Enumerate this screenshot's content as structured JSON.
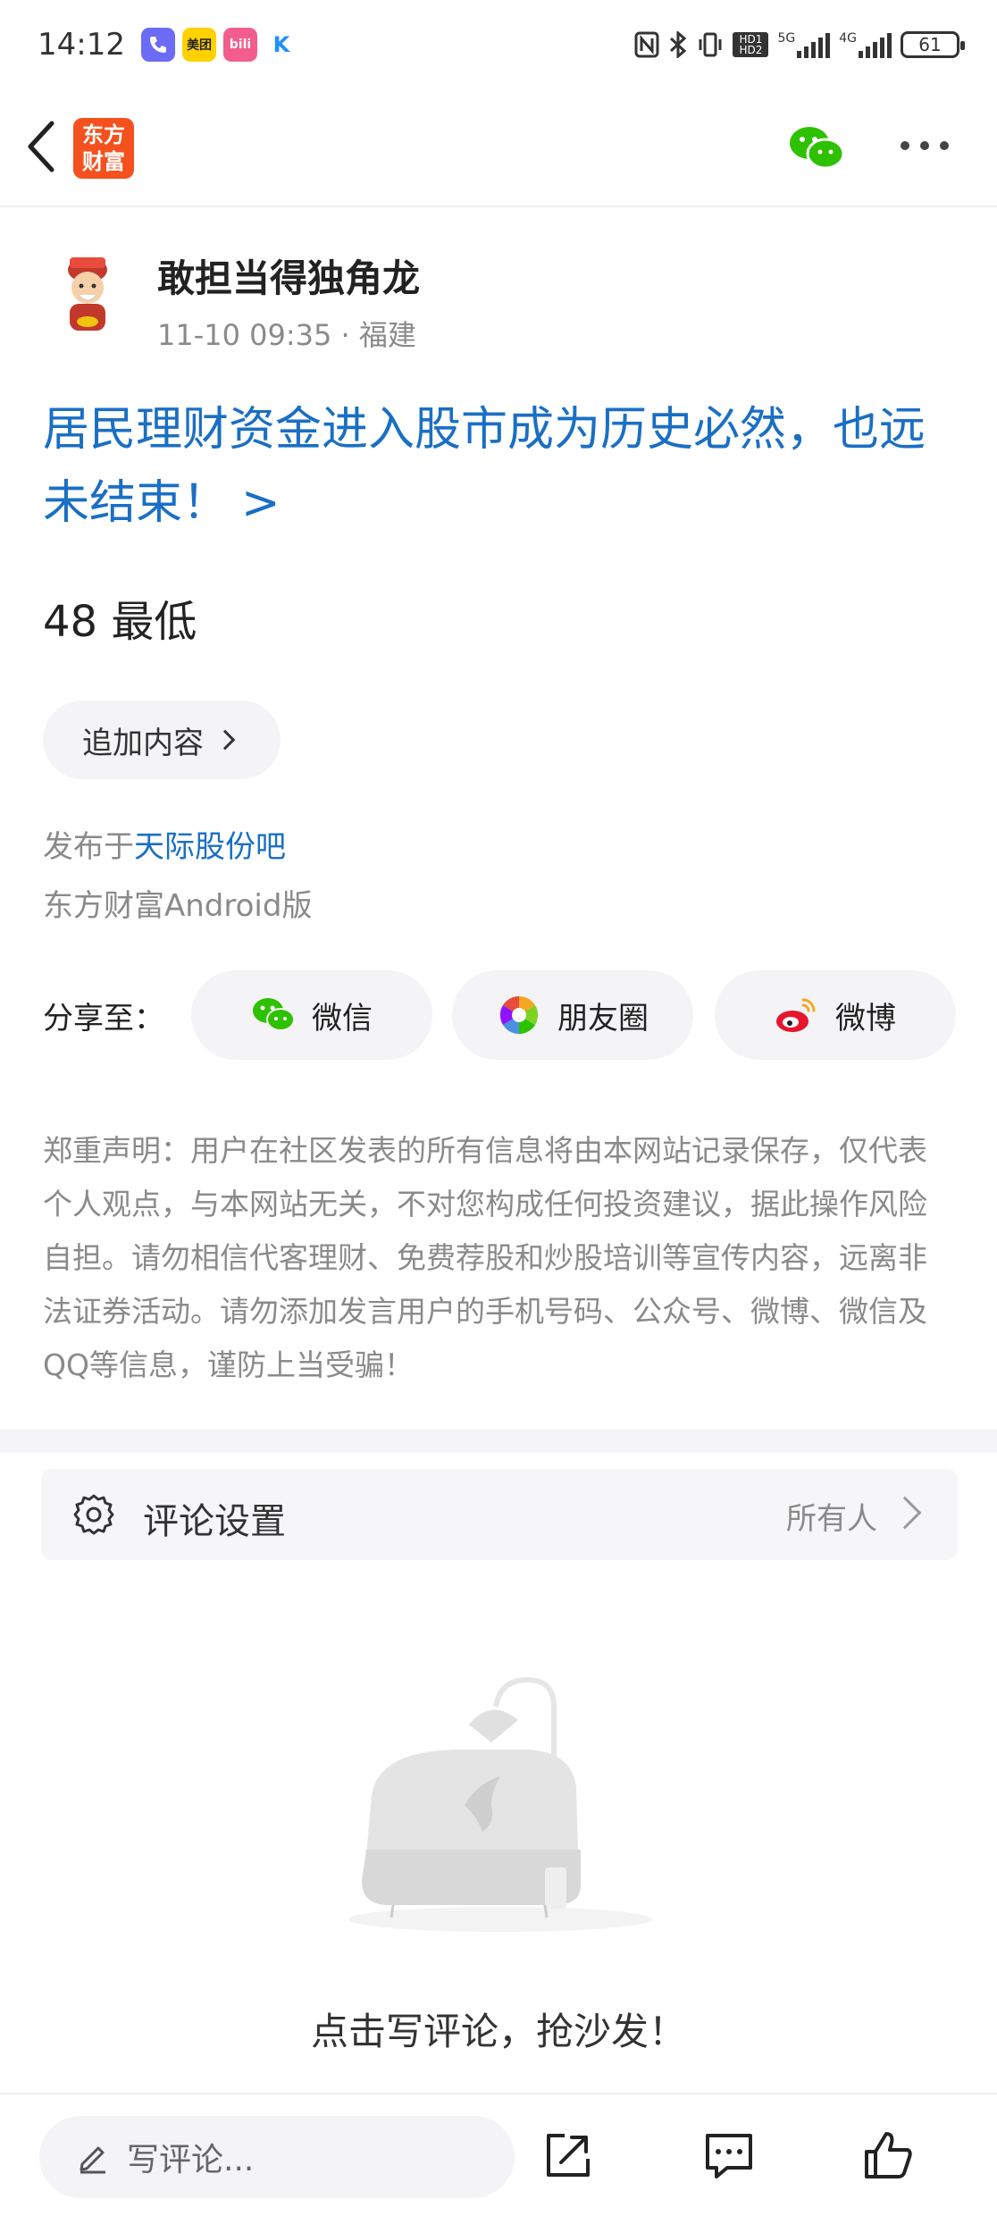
{
  "status_bar": {
    "time": "14:12",
    "apps": [
      {
        "name": "phone-app-icon",
        "label": "",
        "color": "#6b6bf5"
      },
      {
        "name": "meituan-app-icon",
        "label": "美团",
        "color": "#ffd100"
      },
      {
        "name": "bilibili-app-icon",
        "label": "bili",
        "color": "#f25d8e"
      },
      {
        "name": "kuaishou-app-icon",
        "label": "K",
        "color": "#ffffff"
      }
    ],
    "network": [
      "HD1 HD2",
      "5G",
      "4G"
    ],
    "battery": "61"
  },
  "navbar": {
    "logo_line1": "东方",
    "logo_line2": "财富"
  },
  "post": {
    "author": "敢担当得独角龙",
    "meta": "11-10 09:35 · 福建",
    "title": "居民理财资金进入股市成为历史必然，也远未结束！",
    "title_arrow": ">",
    "body": "48 最低",
    "append_label": "追加内容",
    "published_prefix": "发布于",
    "published_link": "天际股份吧",
    "client": "东方财富Android版"
  },
  "share": {
    "label": "分享至：",
    "targets": [
      {
        "label": "微信",
        "icon": "wechat-icon"
      },
      {
        "label": "朋友圈",
        "icon": "moments-icon"
      },
      {
        "label": "微博",
        "icon": "weibo-icon"
      }
    ]
  },
  "disclaimer": "郑重声明：用户在社区发表的所有信息将由本网站记录保存，仅代表个人观点，与本网站无关，不对您构成任何投资建议，据此操作风险自担。请勿相信代客理财、免费荐股和炒股培训等宣传内容，远离非法证券活动。请勿添加发言用户的手机号码、公众号、微博、微信及QQ等信息，谨防上当受骗！",
  "comment_settings": {
    "label": "评论设置",
    "value": "所有人"
  },
  "empty": {
    "text": "点击写评论，抢沙发！"
  },
  "bottom_bar": {
    "placeholder": "写评论..."
  },
  "colors": {
    "brand": "#f4511e",
    "link": "#1a6fc4",
    "wechat": "#2dc100",
    "weibo": "#e6162d"
  }
}
